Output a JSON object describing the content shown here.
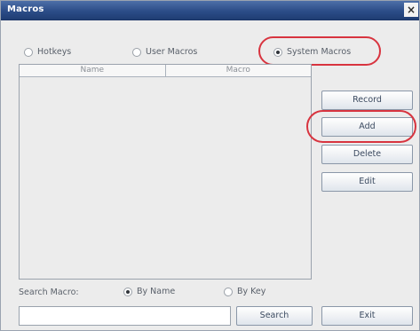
{
  "window": {
    "title": "Macros",
    "close_glyph": "×"
  },
  "macro_type": {
    "options": [
      {
        "label": "Hotkeys",
        "selected": false
      },
      {
        "label": "User Macros",
        "selected": false
      },
      {
        "label": "System Macros",
        "selected": true
      }
    ]
  },
  "table": {
    "columns": [
      "Name",
      "Macro"
    ],
    "rows": []
  },
  "buttons": {
    "record": "Record",
    "add": "Add",
    "delete": "Delete",
    "edit": "Edit"
  },
  "search": {
    "label": "Search Macro:",
    "by_name": {
      "label": "By Name",
      "selected": true
    },
    "by_key": {
      "label": "By Key",
      "selected": false
    },
    "input_value": "",
    "search_button": "Search",
    "exit_button": "Exit"
  },
  "annotation_color": "#d8343f"
}
